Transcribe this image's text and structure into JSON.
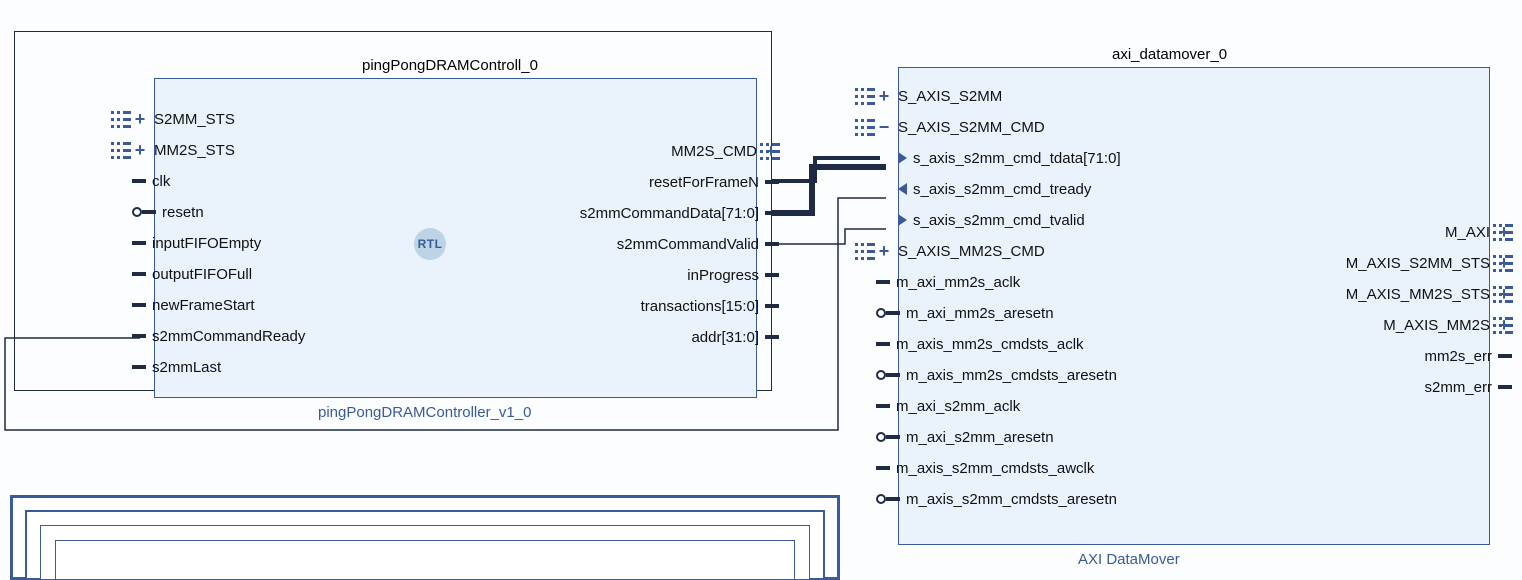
{
  "block1": {
    "title": "pingPongDRAMControll_0",
    "subtitle": "pingPongDRAMController_v1_0",
    "left_ports": [
      {
        "name": "s2mm-sts-bus",
        "label": "S2MM_STS",
        "kind": "bus-expand"
      },
      {
        "name": "mm2s-sts-bus",
        "label": "MM2S_STS",
        "kind": "bus-expand"
      },
      {
        "name": "clk-in",
        "label": "clk",
        "kind": "signal"
      },
      {
        "name": "resetn-in",
        "label": "resetn",
        "kind": "resetn"
      },
      {
        "name": "inputfifoempty-in",
        "label": "inputFIFOEmpty",
        "kind": "signal"
      },
      {
        "name": "outputfifofull-in",
        "label": "outputFIFOFull",
        "kind": "signal"
      },
      {
        "name": "newframestart-in",
        "label": "newFrameStart",
        "kind": "signal"
      },
      {
        "name": "s2mmcommandready-in",
        "label": "s2mmCommandReady",
        "kind": "signal"
      },
      {
        "name": "s2mmlast-in",
        "label": "s2mmLast",
        "kind": "signal"
      }
    ],
    "right_ports": [
      {
        "name": "mm2s-cmd-bus",
        "label": "MM2S_CMD",
        "kind": "bus-expand"
      },
      {
        "name": "resetforframen-out",
        "label": "resetForFrameN",
        "kind": "signal"
      },
      {
        "name": "s2mmcommanddata-out",
        "label": "s2mmCommandData[71:0]",
        "kind": "signal"
      },
      {
        "name": "s2mmcommandvalid-out",
        "label": "s2mmCommandValid",
        "kind": "signal"
      },
      {
        "name": "inprogress-out",
        "label": "inProgress",
        "kind": "signal"
      },
      {
        "name": "transactions-out",
        "label": "transactions[15:0]",
        "kind": "signal"
      },
      {
        "name": "addr-out",
        "label": "addr[31:0]",
        "kind": "signal"
      }
    ],
    "rtl_badge": "RTL"
  },
  "block2": {
    "title": "axi_datamover_0",
    "subtitle": "AXI DataMover",
    "left_ports": [
      {
        "name": "s-axis-s2mm-bus",
        "label": "S_AXIS_S2MM",
        "kind": "bus-expand"
      },
      {
        "name": "s-axis-s2mm-cmd-bus",
        "label": "S_AXIS_S2MM_CMD",
        "kind": "bus-collapse"
      },
      {
        "name": "s-axis-s2mm-cmd-tdata",
        "label": "s_axis_s2mm_cmd_tdata[71:0]",
        "kind": "sub-in"
      },
      {
        "name": "s-axis-s2mm-cmd-tready",
        "label": "s_axis_s2mm_cmd_tready",
        "kind": "sub-out"
      },
      {
        "name": "s-axis-s2mm-cmd-tvalid",
        "label": "s_axis_s2mm_cmd_tvalid",
        "kind": "sub-in"
      },
      {
        "name": "s-axis-mm2s-cmd-bus",
        "label": "S_AXIS_MM2S_CMD",
        "kind": "bus-expand"
      },
      {
        "name": "m-axi-mm2s-aclk",
        "label": "m_axi_mm2s_aclk",
        "kind": "signal"
      },
      {
        "name": "m-axi-mm2s-aresetn",
        "label": "m_axi_mm2s_aresetn",
        "kind": "resetn"
      },
      {
        "name": "m-axis-mm2s-cmdsts-aclk",
        "label": "m_axis_mm2s_cmdsts_aclk",
        "kind": "signal"
      },
      {
        "name": "m-axis-mm2s-cmdsts-aresetn",
        "label": "m_axis_mm2s_cmdsts_aresetn",
        "kind": "resetn"
      },
      {
        "name": "m-axi-s2mm-aclk",
        "label": "m_axi_s2mm_aclk",
        "kind": "signal"
      },
      {
        "name": "m-axi-s2mm-aresetn",
        "label": "m_axi_s2mm_aresetn",
        "kind": "resetn"
      },
      {
        "name": "m-axis-s2mm-cmdsts-awclk",
        "label": "m_axis_s2mm_cmdsts_awclk",
        "kind": "signal"
      },
      {
        "name": "m-axis-s2mm-cmdsts-aresetn",
        "label": "m_axis_s2mm_cmdsts_aresetn",
        "kind": "resetn"
      }
    ],
    "right_ports": [
      {
        "name": "m-axi-bus",
        "label": "M_AXI",
        "kind": "bus-expand"
      },
      {
        "name": "m-axis-s2mm-sts-bus",
        "label": "M_AXIS_S2MM_STS",
        "kind": "bus-expand"
      },
      {
        "name": "m-axis-mm2s-sts-bus",
        "label": "M_AXIS_MM2S_STS",
        "kind": "bus-expand"
      },
      {
        "name": "m-axis-mm2s-bus",
        "label": "M_AXIS_MM2S",
        "kind": "bus-expand"
      },
      {
        "name": "mm2s-err-out",
        "label": "mm2s_err",
        "kind": "signal"
      },
      {
        "name": "s2mm-err-out",
        "label": "s2mm_err",
        "kind": "signal"
      }
    ]
  }
}
